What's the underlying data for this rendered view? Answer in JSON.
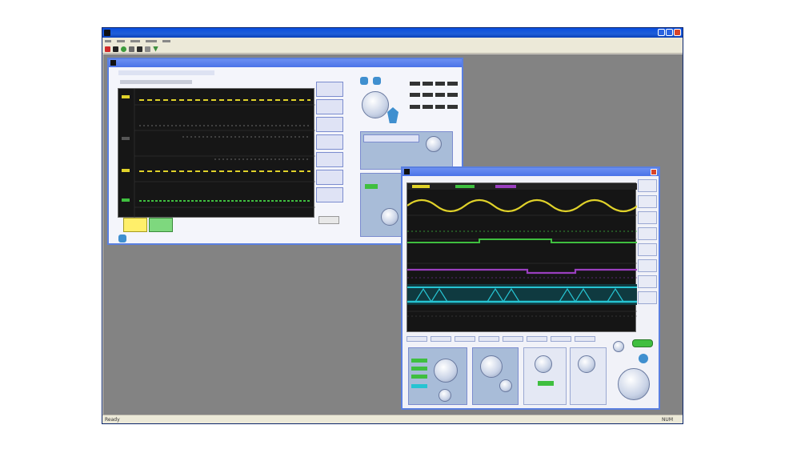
{
  "app": {
    "title": "",
    "menu": [],
    "status_left": "Ready",
    "status_right": "NUM",
    "colors": {
      "titlebar": "#0a4ee0",
      "mdi_bg": "#838383"
    }
  },
  "windows": [
    {
      "id": "c1",
      "title": ""
    },
    {
      "id": "c2",
      "title": ""
    }
  ],
  "trace_colors": {
    "ch1": "#e0d22a",
    "ch2": "#3fbf3f",
    "ch3": "#9a3fbf",
    "ch4": "#26c4d2"
  },
  "icons": [
    "app-icon",
    "minimize-icon",
    "maximize-icon",
    "close-icon",
    "knob-icon",
    "window-icon"
  ]
}
